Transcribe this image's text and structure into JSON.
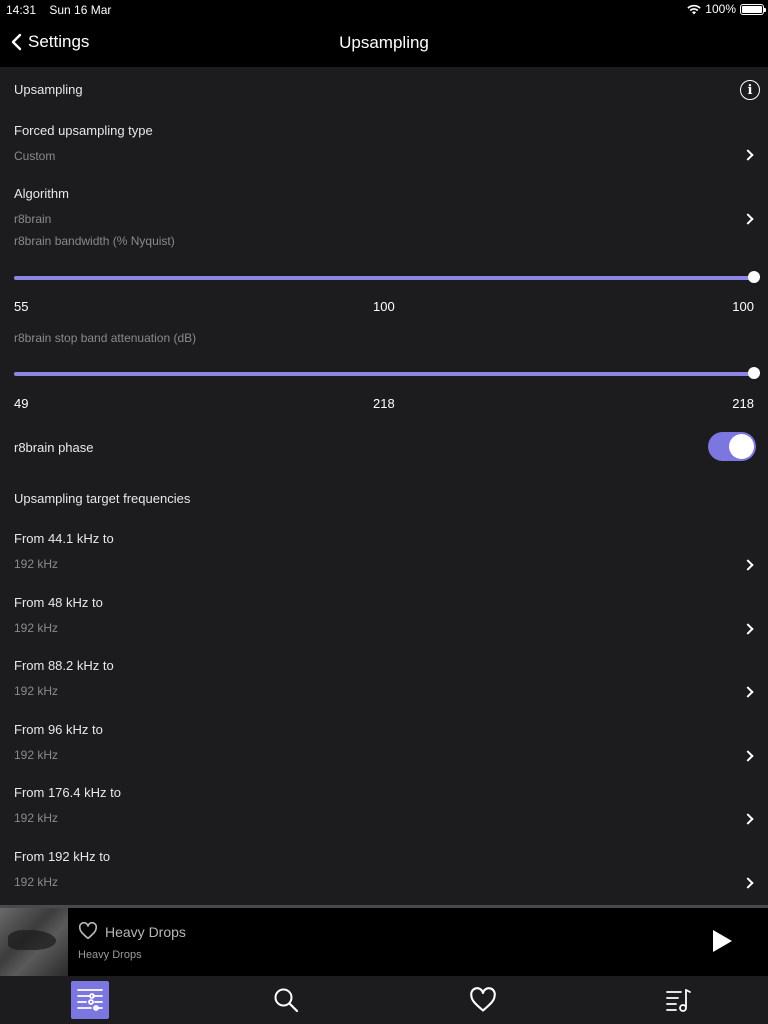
{
  "status_bar": {
    "time": "14:31",
    "date": "Sun 16 Mar",
    "battery": "100%",
    "battery_level": 1.0
  },
  "nav": {
    "back_label": "Settings",
    "title": "Upsampling"
  },
  "section": {
    "title": "Upsampling",
    "info_icon": "info-icon"
  },
  "forced_type": {
    "label": "Forced upsampling type",
    "value": "Custom"
  },
  "algorithm": {
    "label": "Algorithm",
    "value": "r8brain"
  },
  "bandwidth": {
    "label": "r8brain bandwidth (% Nyquist)",
    "min": "55",
    "current": "100",
    "max": "100",
    "fraction": 1.0
  },
  "attenuation": {
    "label": "r8brain stop band attenuation (dB)",
    "min": "49",
    "current": "218",
    "max": "218",
    "fraction": 1.0
  },
  "phase": {
    "label": "r8brain phase",
    "enabled": true
  },
  "targets": {
    "header": "Upsampling target frequencies",
    "items": [
      {
        "label": "From 44.1 kHz to",
        "value": "192 kHz"
      },
      {
        "label": "From 48 kHz to",
        "value": "192 kHz"
      },
      {
        "label": "From 88.2 kHz to",
        "value": "192 kHz"
      },
      {
        "label": "From 96 kHz to",
        "value": "192 kHz"
      },
      {
        "label": "From 176.4 kHz to",
        "value": "192 kHz"
      },
      {
        "label": "From 192 kHz to",
        "value": "192 kHz"
      }
    ]
  },
  "player": {
    "title": "Heavy Drops",
    "artist": "Heavy Drops"
  },
  "tabs": [
    {
      "icon": "settings-sliders-icon",
      "active": true
    },
    {
      "icon": "search-icon",
      "active": false
    },
    {
      "icon": "heart-icon",
      "active": false
    },
    {
      "icon": "playlist-music-icon",
      "active": false
    }
  ],
  "colors": {
    "accent": "#7b76e0",
    "background": "#1c1c1e",
    "bar": "#000000"
  }
}
